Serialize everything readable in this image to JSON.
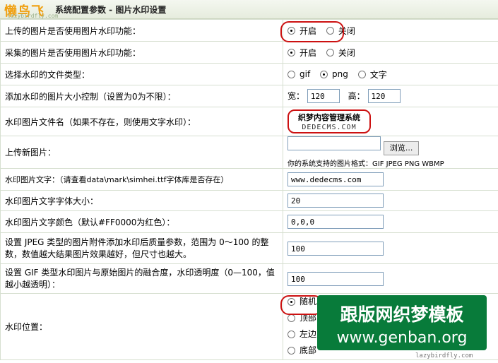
{
  "header": {
    "title": "系统配置参数 - 图片水印设置",
    "logo": "懒鸟飞",
    "logo_sub": "lazybirdfly.com"
  },
  "rows": {
    "enable": {
      "label": "上传的图片是否使用图片水印功能：",
      "opt_on": "开启",
      "opt_off": "关闭"
    },
    "collect": {
      "label": "采集的图片是否使用图片水印功能：",
      "opt_on": "开启",
      "opt_off": "关闭"
    },
    "type": {
      "label": "选择水印的文件类型：",
      "opt1": "gif",
      "opt2": "png",
      "opt3": "文字"
    },
    "size": {
      "label": "添加水印的图片大小控制（设置为0为不限）：",
      "w_label": "宽：",
      "w_val": "120",
      "h_label": "高：",
      "h_val": "120"
    },
    "file": {
      "label": "水印图片文件名（如果不存在，则使用文字水印）：",
      "preview_line1": "织梦内容管理系统",
      "preview_line2": "DEDECMS.COM"
    },
    "upload": {
      "label": "上传新图片：",
      "browse": "浏览...",
      "supported": "你的系统支持的图片格式：GIF JPEG PNG WBMP"
    },
    "text": {
      "label": "水印图片文字：（请查看data\\mark\\simhei.ttf字体库是否存在）",
      "value": "www.dedecms.com"
    },
    "fontsize": {
      "label": "水印图片文字字体大小：",
      "value": "20"
    },
    "color": {
      "label": "水印图片文字颜色（默认#FF0000为红色）：",
      "value": "0,0,0"
    },
    "jpeg": {
      "label": "设置 JPEG 类型的图片附件添加水印后质量参数，范围为 0～100 的整数，数值越大结果图片效果越好，但尺寸也越大。",
      "value": "100"
    },
    "gif": {
      "label": "设置 GIF 类型水印图片与原始图片的融合度，水印透明度（0—100，值越小越透明）：",
      "value": "100"
    },
    "position": {
      "label": "水印位置：",
      "opt1": "随机",
      "opt2": "顶部",
      "opt3": "左边",
      "opt4": "底部"
    }
  },
  "watermark": {
    "line1": "跟版网织梦模板",
    "line2": "www.genban.org",
    "sub": "lazybirdfly.com"
  }
}
